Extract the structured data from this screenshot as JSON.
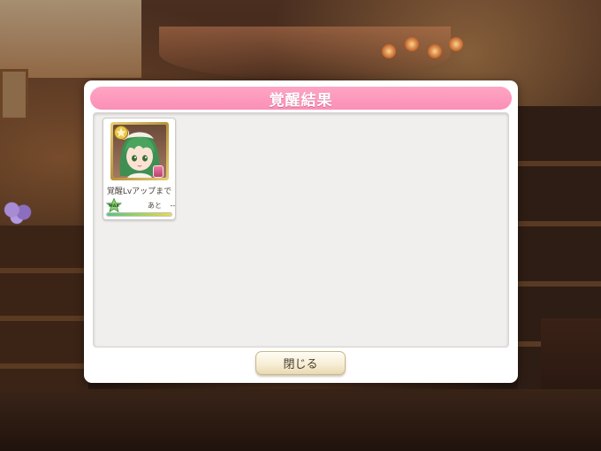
{
  "dialog": {
    "title": "覚醒結果",
    "close_label": "閉じる"
  },
  "result_card": {
    "label": "覚醒Lvアップまで",
    "remaining_label": "あと",
    "remaining_value": "--",
    "max_badge": "MAX",
    "progress": 1.0,
    "element_icon": "fire-icon",
    "rarity_icon": "gold-medal-icon",
    "weapon_icon": "weapon-icon"
  },
  "colors": {
    "header_pink": "#fb8fb5",
    "progress_start": "#53c58b",
    "progress_end": "#ecd84a"
  }
}
